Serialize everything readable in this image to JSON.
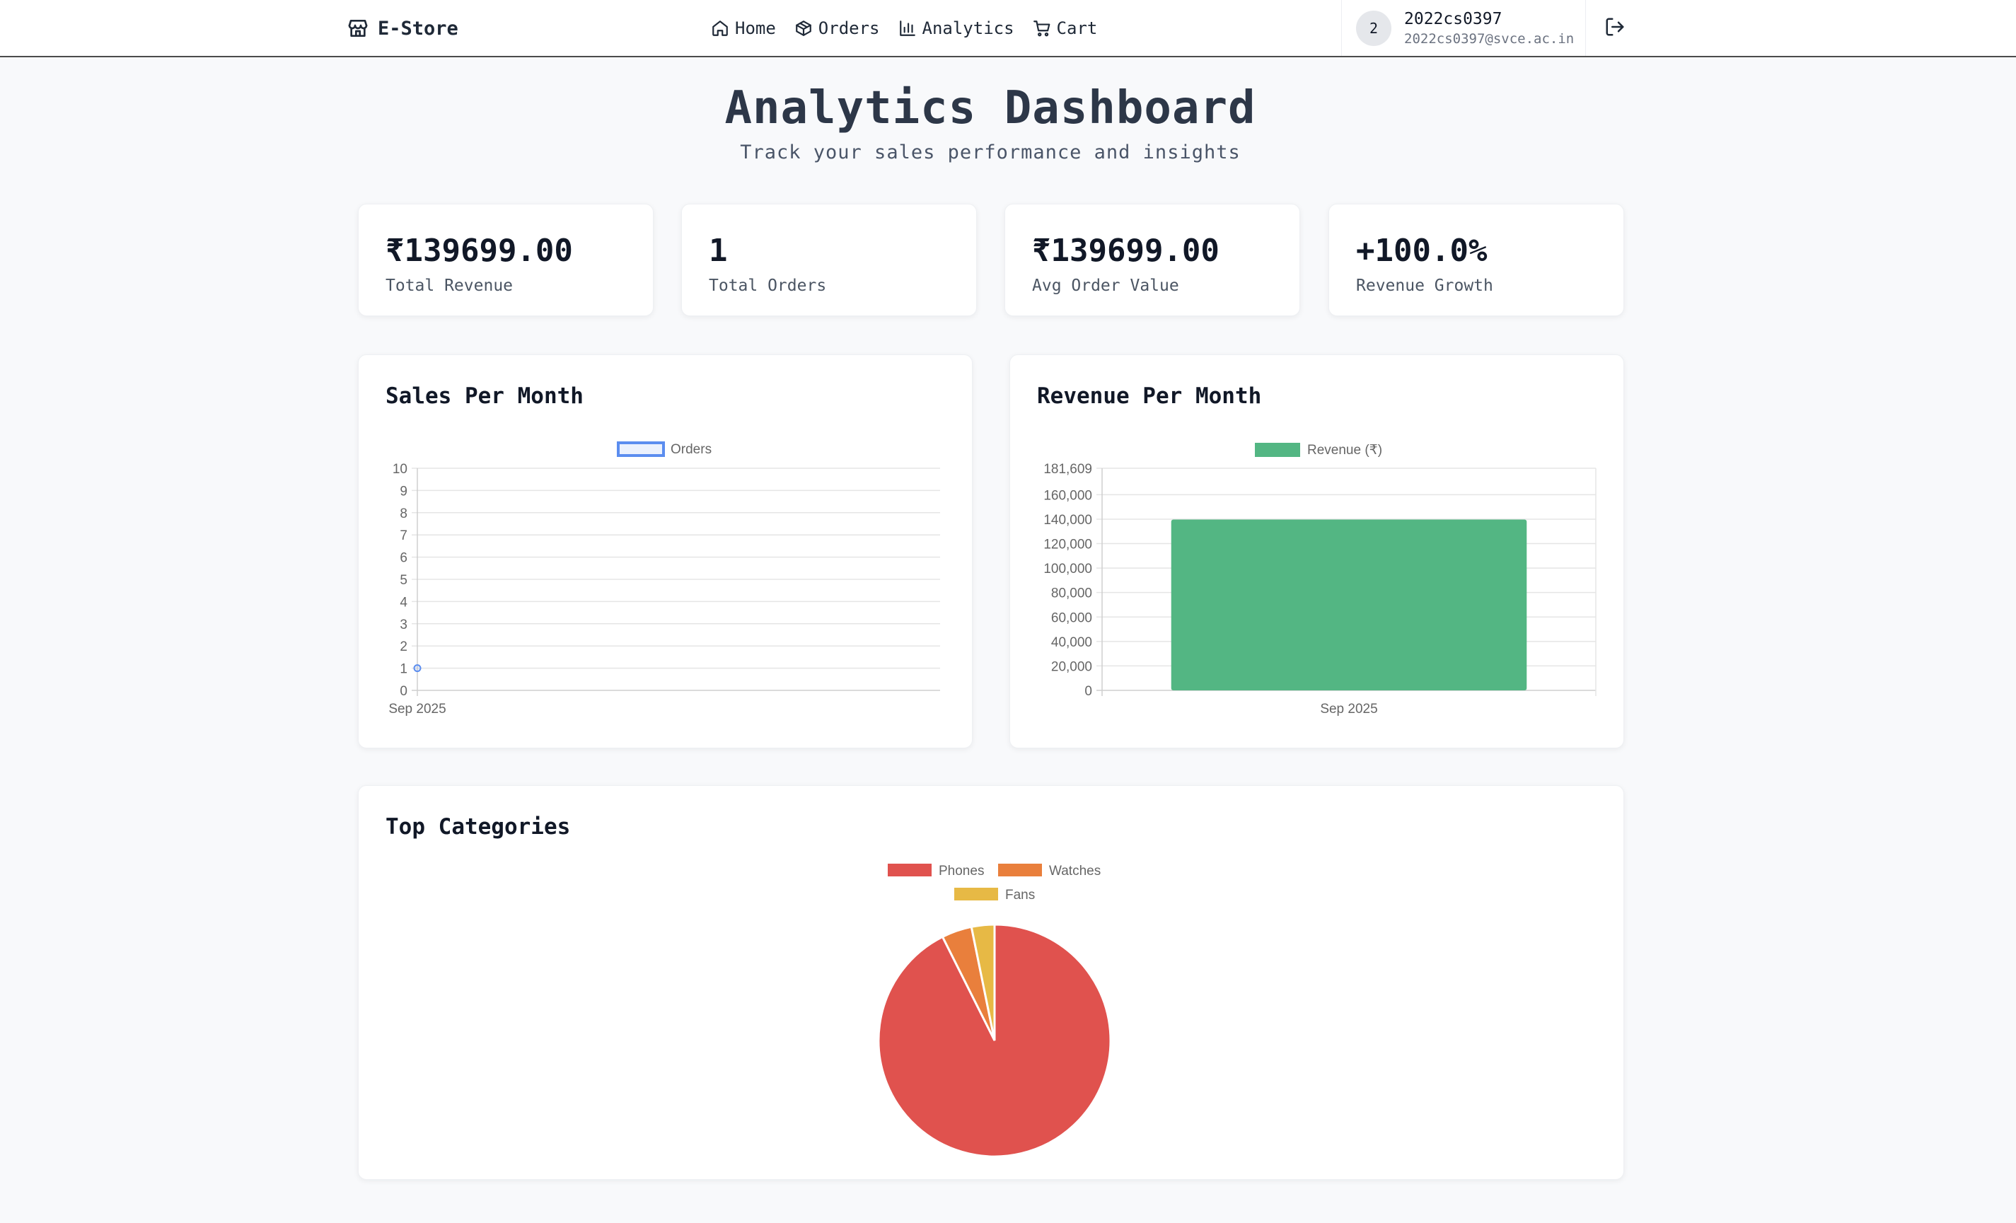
{
  "navbar": {
    "brand": "E-Store",
    "links": [
      {
        "label": "Home",
        "icon": "home-icon"
      },
      {
        "label": "Orders",
        "icon": "box-icon"
      },
      {
        "label": "Analytics",
        "icon": "bar-chart-icon"
      },
      {
        "label": "Cart",
        "icon": "cart-icon"
      }
    ],
    "user": {
      "avatar_initial": "2",
      "name": "2022cs0397",
      "email": "2022cs0397@svce.ac.in"
    },
    "logout_icon": "logout-icon"
  },
  "header": {
    "title": "Analytics Dashboard",
    "subtitle": "Track your sales performance and insights"
  },
  "stats": [
    {
      "value": "₹139699.00",
      "label": "Total Revenue"
    },
    {
      "value": "1",
      "label": "Total Orders"
    },
    {
      "value": "₹139699.00",
      "label": "Avg Order Value"
    },
    {
      "value": "+100.0%",
      "label": "Revenue Growth"
    }
  ],
  "colors": {
    "line": "#5b8def",
    "bar": "#53b683",
    "phones": "#e0524e",
    "watches": "#e97f3c",
    "fans": "#e7b945"
  },
  "chart_data": [
    {
      "type": "line",
      "title": "Sales Per Month",
      "x": [
        "Sep 2025"
      ],
      "series": [
        {
          "name": "Orders",
          "values": [
            1
          ]
        }
      ],
      "ylim": [
        0,
        10
      ],
      "yticks": [
        "0",
        "1",
        "2",
        "3",
        "4",
        "5",
        "6",
        "7",
        "8",
        "9",
        "10"
      ],
      "grid": true,
      "legend": "top"
    },
    {
      "type": "bar",
      "title": "Revenue Per Month",
      "categories": [
        "Sep 2025"
      ],
      "series": [
        {
          "name": "Revenue (₹)",
          "values": [
            139699
          ]
        }
      ],
      "ylim": [
        0,
        181609
      ],
      "yticks": [
        "0",
        "20,000",
        "40,000",
        "60,000",
        "80,000",
        "100,000",
        "120,000",
        "140,000",
        "160,000",
        "181,609"
      ],
      "grid": true,
      "legend": "top"
    },
    {
      "type": "pie",
      "title": "Top Categories",
      "categories": [
        "Phones",
        "Watches",
        "Fans"
      ],
      "values": [
        92.6,
        4.2,
        3.2
      ],
      "legend": "top"
    }
  ]
}
